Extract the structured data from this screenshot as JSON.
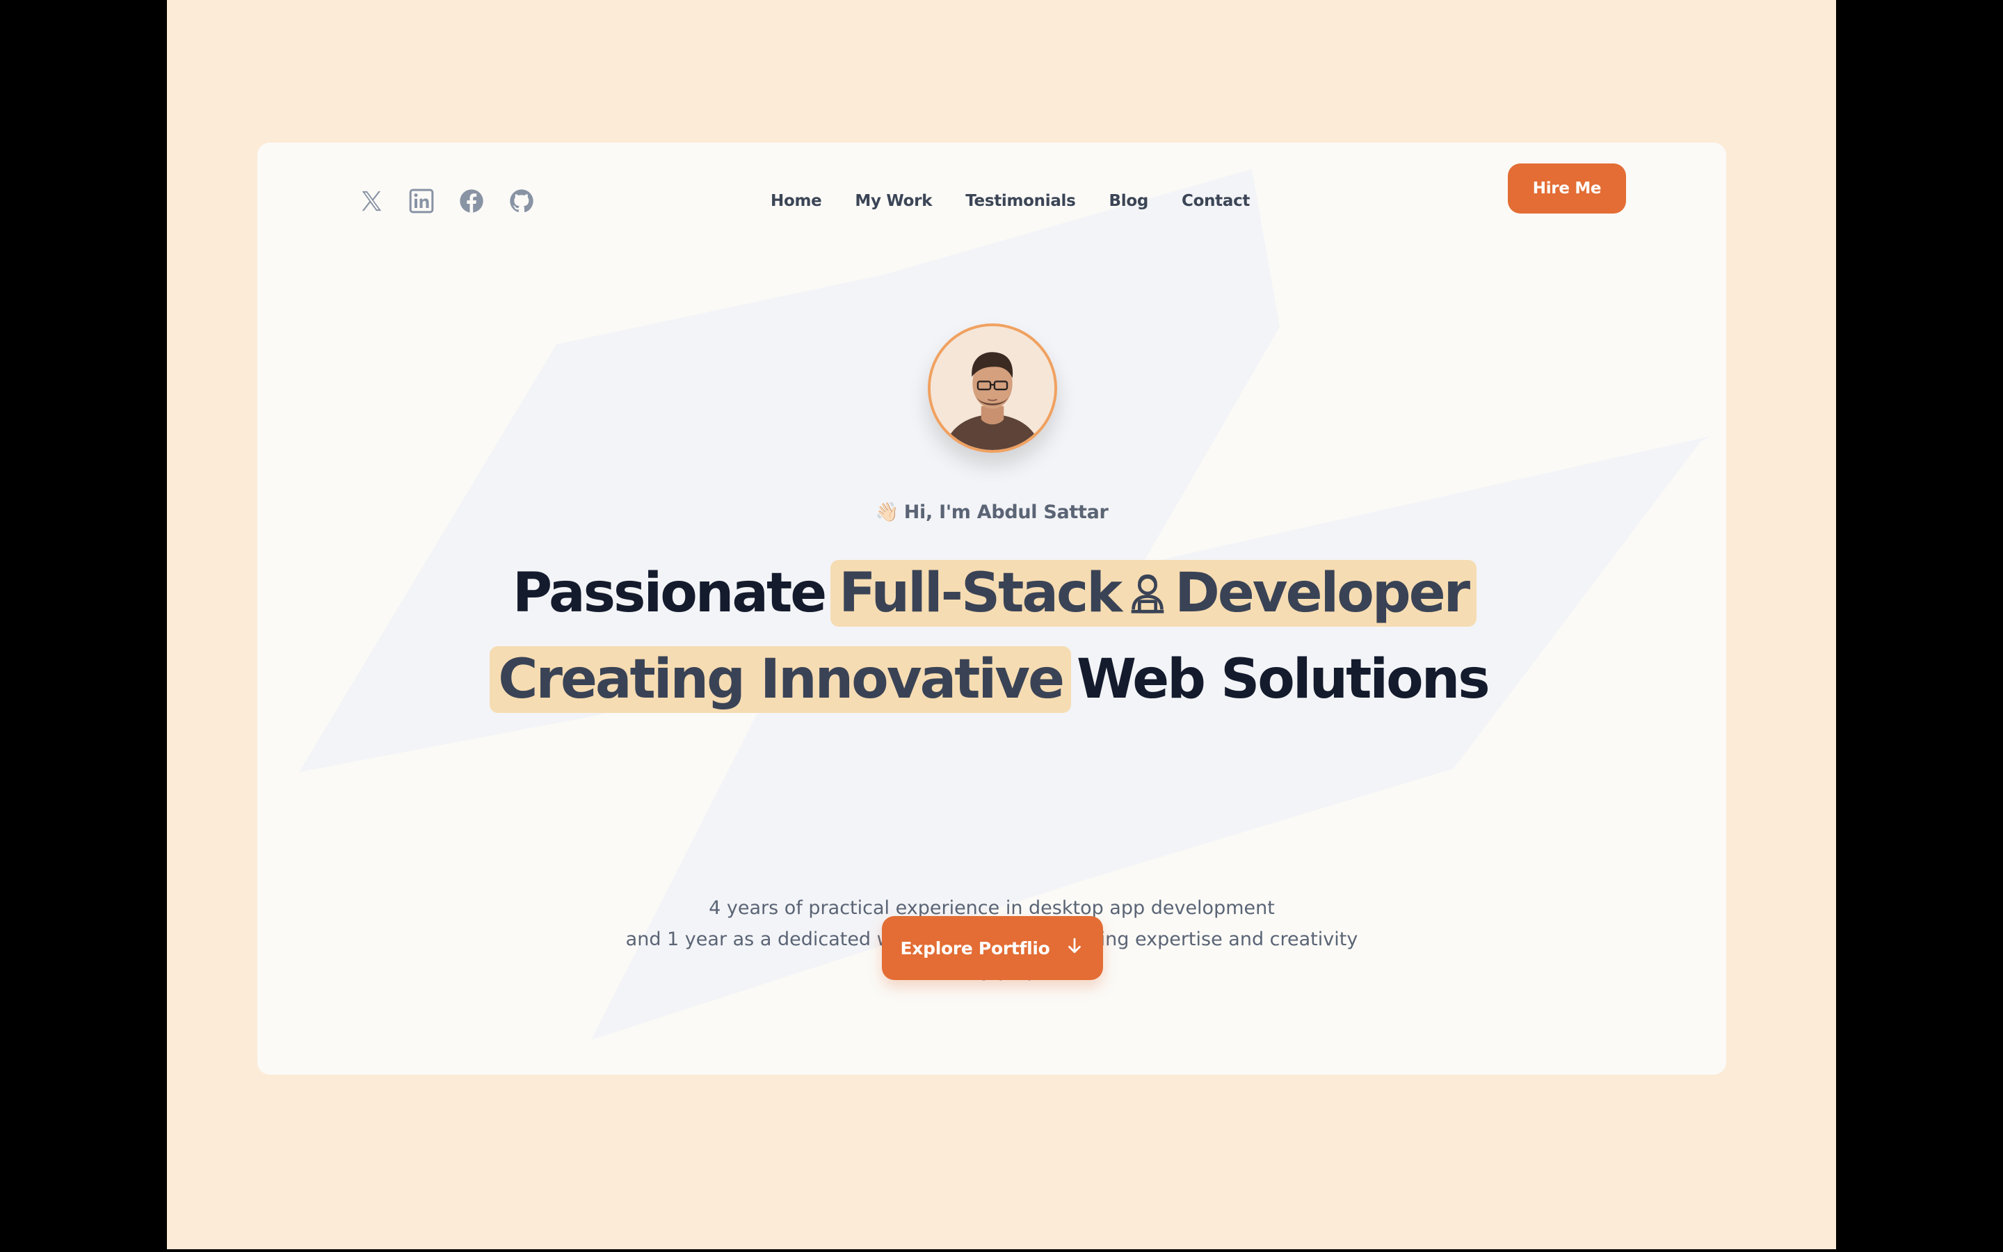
{
  "social": [
    {
      "name": "x-icon"
    },
    {
      "name": "linkedin-icon"
    },
    {
      "name": "facebook-icon"
    },
    {
      "name": "github-icon"
    }
  ],
  "nav": {
    "items": [
      "Home",
      "My Work",
      "Testimonials",
      "Blog",
      "Contact"
    ]
  },
  "header": {
    "hire_label": "Hire Me"
  },
  "hero": {
    "wave_emoji": "👋🏻",
    "greeting": "Hi, I'm Abdul Sattar",
    "headline_line1_plain": "Passionate",
    "headline_line1_highlight_a": "Full-Stack",
    "headline_line1_highlight_b": "Developer",
    "headline_icon": "developer-icon",
    "headline_line2_highlight": "Creating Innovative",
    "headline_line2_plain": "Web Solutions",
    "description_lines": [
      "4 years of practical experience in desktop app development",
      "and 1 year as a dedicated web app developer, I bring expertise and creativity",
      "to every project."
    ],
    "cta_label": "Explore Portflio",
    "cta_icon": "arrow-down-icon"
  },
  "colors": {
    "accent": "#e36d34",
    "highlight": "#f6dcb3",
    "background": "#fcebd7",
    "card": "#fbfaf7",
    "heading": "#141b2d",
    "text_muted": "#5a6475"
  }
}
